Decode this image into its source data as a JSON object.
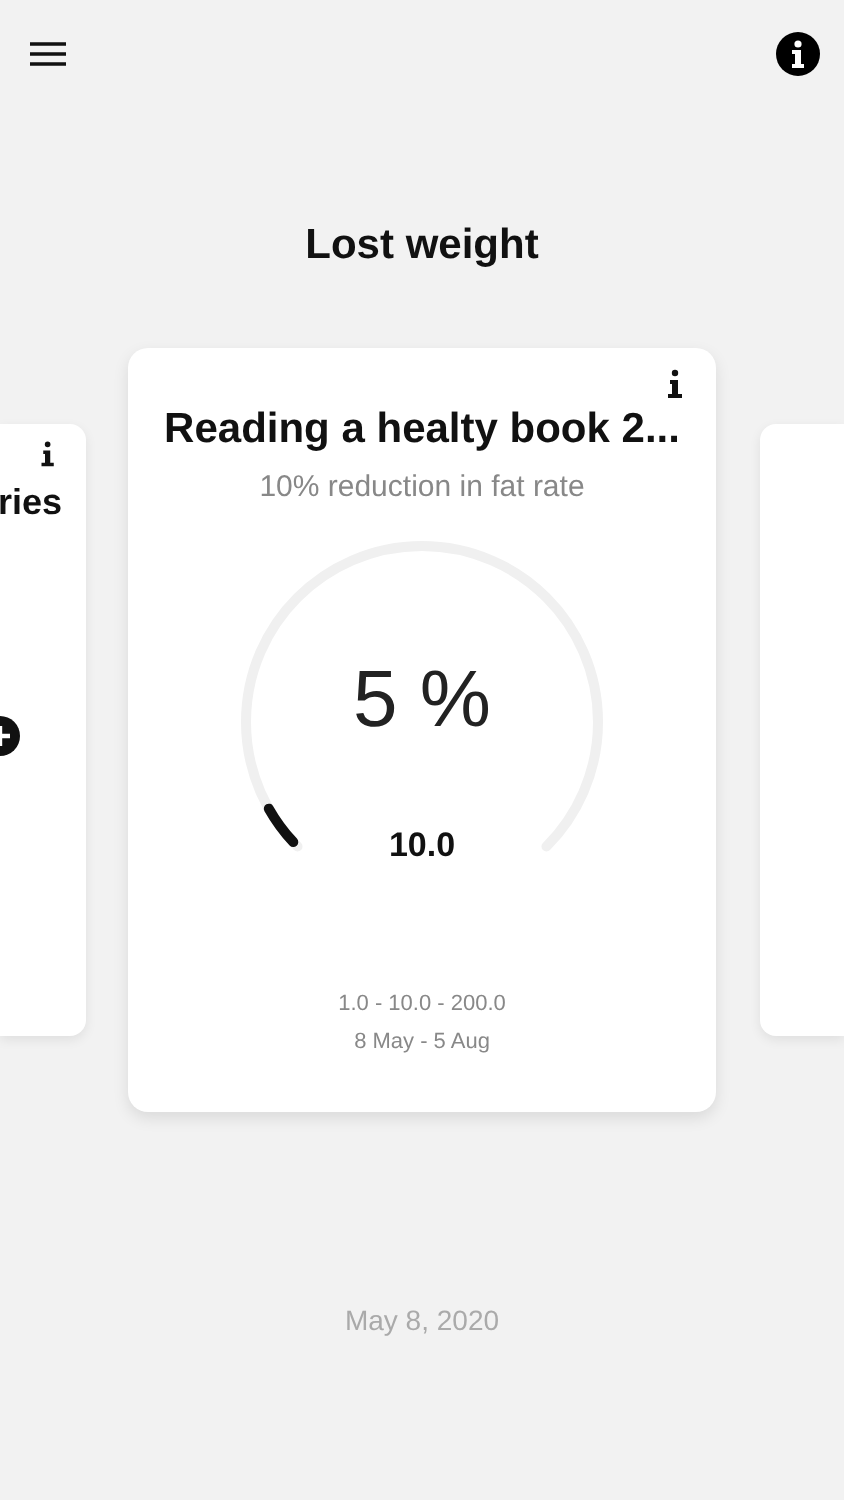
{
  "title": "Lost weight",
  "cards": [
    {
      "kind": "side",
      "title": "ries"
    },
    {
      "kind": "main",
      "title": "Reading a healty book 2...",
      "subtitle": "10% reduction in fat rate",
      "percent": "5 %",
      "value": "10.0",
      "level": 0.05,
      "range": "1.0 - 10.0 - 200.0",
      "dates": "8 May - 5 Aug"
    },
    {
      "kind": "blank"
    }
  ],
  "date": "May 8, 2020"
}
